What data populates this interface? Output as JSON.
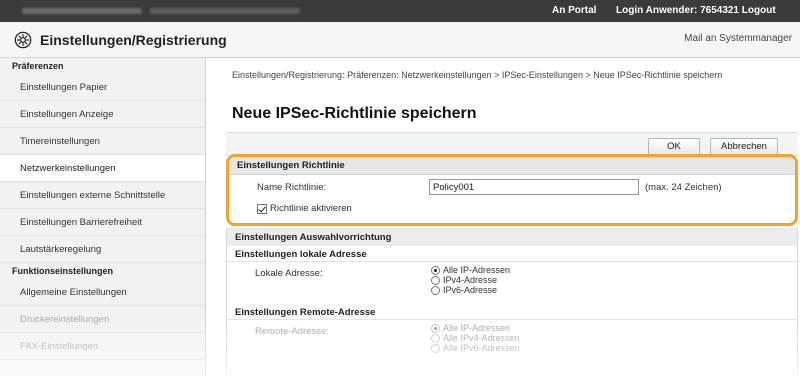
{
  "topbar": {
    "portal_link": "An Portal",
    "login_user": "Login Anwender:  7654321  Logout"
  },
  "header": {
    "title": "Einstellungen/Registrierung",
    "mail_link": "Mail an Systemmanager",
    "icon": "gear-icon"
  },
  "sidebar": {
    "sections": [
      {
        "title": "Präferenzen",
        "items": [
          {
            "label": "Einstellungen Papier"
          },
          {
            "label": "Einstellungen Anzeige"
          },
          {
            "label": "Timereinstellungen"
          },
          {
            "label": "Netzwerkeinstellungen",
            "active": true
          },
          {
            "label": "Einstellungen externe Schnittstelle"
          },
          {
            "label": "Einstellungen Barrierefreiheit"
          },
          {
            "label": "Lautstärkeregelung"
          }
        ]
      },
      {
        "title": "Funktionseinstellungen",
        "items": [
          {
            "label": "Allgemeine Einstellungen"
          },
          {
            "label": "Druckereinstellungen"
          },
          {
            "label": "FAX-Einstellungen"
          }
        ]
      }
    ]
  },
  "main": {
    "breadcrumb": "Einstellungen/Registrierung: Präferenzen: Netzwerkeinstellungen > IPSec-Einstellungen > Neue IPSec-Richtlinie speichern",
    "page_title": "Neue IPSec-Richtlinie speichern",
    "buttons": {
      "ok": "OK",
      "cancel": "Abbrechen"
    },
    "policy_settings": {
      "title": "Einstellungen Richtlinie",
      "name_label": "Name Richtlinie:",
      "name_value": "Policy001",
      "name_hint": "(max. 24 Zeichen)",
      "enable_label": "Richtlinie aktivieren",
      "enable_checked": true
    },
    "selector_settings": {
      "title": "Einstellungen Auswahlvorrichtung",
      "local": {
        "title": "Einstellungen lokale Adresse",
        "label": "Lokale Adresse:",
        "options": [
          "Alle IP-Adressen",
          "IPv4-Adresse",
          "IPv6-Adresse"
        ],
        "selected": "Alle IP-Adressen"
      },
      "remote": {
        "title": "Einstellungen Remote-Adresse",
        "label": "Remote-Adresse:",
        "options": [
          "Alle IP-Adressen",
          "Alle IPv4-Adressen",
          "Alle IPv6-Adressen"
        ],
        "selected": "Alle IP-Adressen"
      }
    }
  },
  "colors": {
    "highlight": "#f2a32a",
    "topbar": "#3b3b3b"
  }
}
